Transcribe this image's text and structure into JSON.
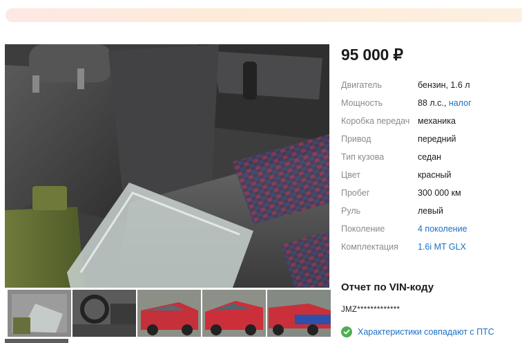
{
  "listing": {
    "price": "95 000 ₽"
  },
  "specs": [
    {
      "label": "Двигатель",
      "value": "бензин, 1.6 л",
      "link": ""
    },
    {
      "label": "Мощность",
      "value": "88 л.с.,",
      "link": "налог"
    },
    {
      "label": "Коробка передач",
      "value": "механика",
      "link": ""
    },
    {
      "label": "Привод",
      "value": "передний",
      "link": ""
    },
    {
      "label": "Тип кузова",
      "value": "седан",
      "link": ""
    },
    {
      "label": "Цвет",
      "value": "красный",
      "link": ""
    },
    {
      "label": "Пробег",
      "value": "300 000 км",
      "link": ""
    },
    {
      "label": "Руль",
      "value": "левый",
      "link": ""
    },
    {
      "label": "Поколение",
      "value": "",
      "link": "4 поколение"
    },
    {
      "label": "Комплектация",
      "value": "",
      "link": "1.6i MT GLX"
    }
  ],
  "vin_report": {
    "title": "Отчет по VIN-коду",
    "vin": "JMZ*************",
    "check_text": "Характеристики совпадают с ПТС"
  },
  "colors": {
    "link": "#1c6fc4",
    "check": "#4caf50",
    "banner": "#fde8e4"
  },
  "gallery": {
    "thumbnail_count": 5
  }
}
